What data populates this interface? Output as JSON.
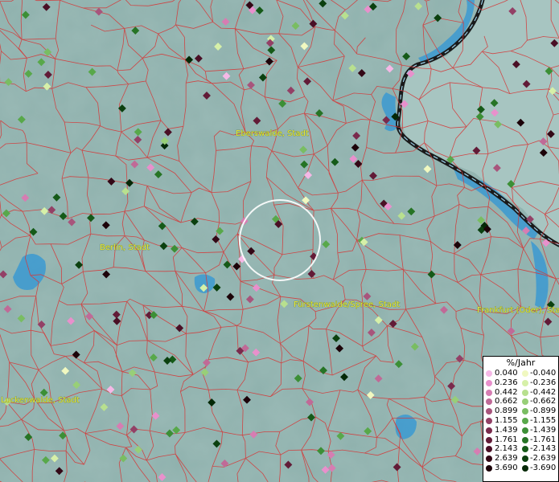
{
  "map": {
    "cities": [
      {
        "name": "Eberswalde, Stadt"
      },
      {
        "name": "Berlin, Stadt"
      },
      {
        "name": "Fürstenwalde/Spree, Stadt"
      },
      {
        "name": "Frankfurt (Oder), Stadt"
      },
      {
        "name": "Luckenwalde, Stadt"
      }
    ],
    "colors": {
      "background": "#8fb1ad",
      "borders": "#d43a3a",
      "water": "#2f95d6",
      "national_border": "#1a1a1a"
    }
  },
  "legend": {
    "title": "%/Jahr",
    "positive": [
      {
        "label": "0.040",
        "color": "#f5b8e6"
      },
      {
        "label": "0.236",
        "color": "#e890cc"
      },
      {
        "label": "0.442",
        "color": "#d67db2"
      },
      {
        "label": "0.662",
        "color": "#c06a97"
      },
      {
        "label": "0.899",
        "color": "#a8557c"
      },
      {
        "label": "1.155",
        "color": "#934066"
      },
      {
        "label": "1.439",
        "color": "#7a2a4c"
      },
      {
        "label": "1.761",
        "color": "#621b37"
      },
      {
        "label": "2.143",
        "color": "#4a0f25"
      },
      {
        "label": "2.639",
        "color": "#330816"
      },
      {
        "label": "3.690",
        "color": "#1c0309"
      }
    ],
    "negative": [
      {
        "label": "-0.040",
        "color": "#f0f8c0"
      },
      {
        "label": "-0.236",
        "color": "#d6f0a8"
      },
      {
        "label": "-0.442",
        "color": "#b8e08f"
      },
      {
        "label": "-0.662",
        "color": "#98cf78"
      },
      {
        "label": "-0.899",
        "color": "#79bd62"
      },
      {
        "label": "-1.155",
        "color": "#58a84a"
      },
      {
        "label": "-1.439",
        "color": "#3c8f36"
      },
      {
        "label": "-1.761",
        "color": "#267425"
      },
      {
        "label": "-2.143",
        "color": "#155a18"
      },
      {
        "label": "-2.639",
        "color": "#0b400f"
      },
      {
        "label": "-3.690",
        "color": "#042806"
      }
    ]
  }
}
